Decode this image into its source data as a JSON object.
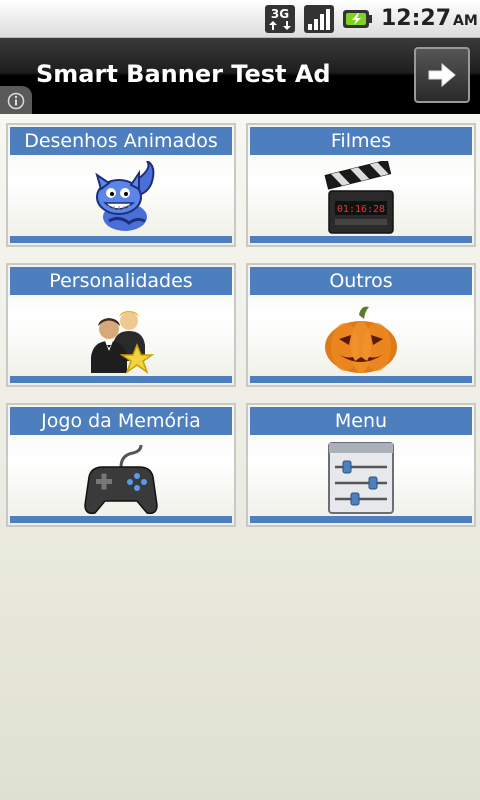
{
  "status_bar": {
    "network": "3G",
    "time": "12:27",
    "ampm": "AM",
    "icons": [
      "3g-data-icon",
      "signal-strength-icon",
      "battery-charging-icon"
    ]
  },
  "ad_banner": {
    "title": "Smart Banner Test Ad",
    "info_icon": "info-icon",
    "arrow_icon": "arrow-right-icon"
  },
  "menu": {
    "accent_color": "#4d7fbf",
    "tiles": [
      {
        "label": "Desenhos Animados",
        "icon": "cheshire-cat-icon"
      },
      {
        "label": "Filmes",
        "icon": "clapperboard-icon"
      },
      {
        "label": "Personalidades",
        "icon": "people-star-icon"
      },
      {
        "label": "Outros",
        "icon": "pumpkin-icon"
      },
      {
        "label": "Jogo da Memória",
        "icon": "gamepad-icon"
      },
      {
        "label": "Menu",
        "icon": "settings-sliders-icon"
      }
    ]
  }
}
